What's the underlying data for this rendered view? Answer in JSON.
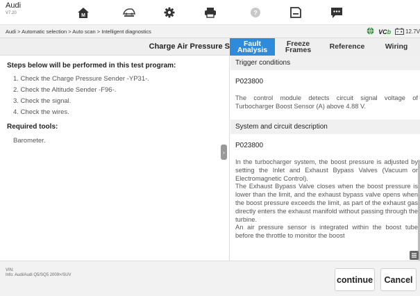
{
  "app": {
    "name": "Audi",
    "version": "V7.20"
  },
  "toolbar": {
    "icons": [
      "home-icon",
      "vehicle-menu-icon",
      "settings-icon",
      "print-icon",
      "help-icon",
      "save-icon",
      "chat-icon"
    ]
  },
  "breadcrumb": "Audi > Automatic selection > Auto scan > Intelligent diagnostics",
  "status": {
    "vci": "VCb",
    "voltage": "12.7V"
  },
  "page_title": "Charge Air Pressure S",
  "tabs": [
    {
      "line1": "Fault",
      "line2": "Analysis",
      "active": true
    },
    {
      "line1": "Freeze",
      "line2": "Frames",
      "active": false
    },
    {
      "line1": "Reference",
      "line2": "",
      "active": false
    },
    {
      "line1": "Wiring",
      "line2": "",
      "active": false
    }
  ],
  "left": {
    "steps_heading": "Steps below will be performed in this test program:",
    "steps": [
      "1. Check the Charge Pressure Sender -YP31-.",
      "2. Check the Altitude Sender -F96-.",
      "3. Check the signal.",
      "4. Check the wires."
    ],
    "tools_heading": "Required tools:",
    "tools": [
      "Barometer."
    ]
  },
  "right": {
    "trigger_heading": "Trigger conditions",
    "trigger_code": "P023800",
    "trigger_text": "The control module detects circuit signal voltage of Turbocharger Boost Sensor (A) above 4.88 V.",
    "system_heading": "System and circuit description",
    "system_code": "P023800",
    "system_paragraphs": [
      "In the turbocharger system, the boost pressure is adjusted by setting the Inlet and Exhaust Bypass Valves (Vacuum or Electromagnetic Control).",
      "The Exhaust Bypass Valve closes when the boost pressure is lower than the limit, and the exhaust bypass valve opens when the boost pressure exceeds the limit, as part of the exhaust gas directly enters the exhaust manifold without passing through the turbine.",
      "An air pressure sensor is integrated within the boost tube before the throttle to monitor the boost"
    ]
  },
  "footer": {
    "vin_label": "VIN:",
    "info": "Info: Audi/Audi Q5/SQ5 2009>/SUV",
    "continue_label": "continue",
    "cancel_label": "Cancel"
  },
  "colors": {
    "accent": "#2e8bdb",
    "battery_green": "#2e9b3a"
  }
}
